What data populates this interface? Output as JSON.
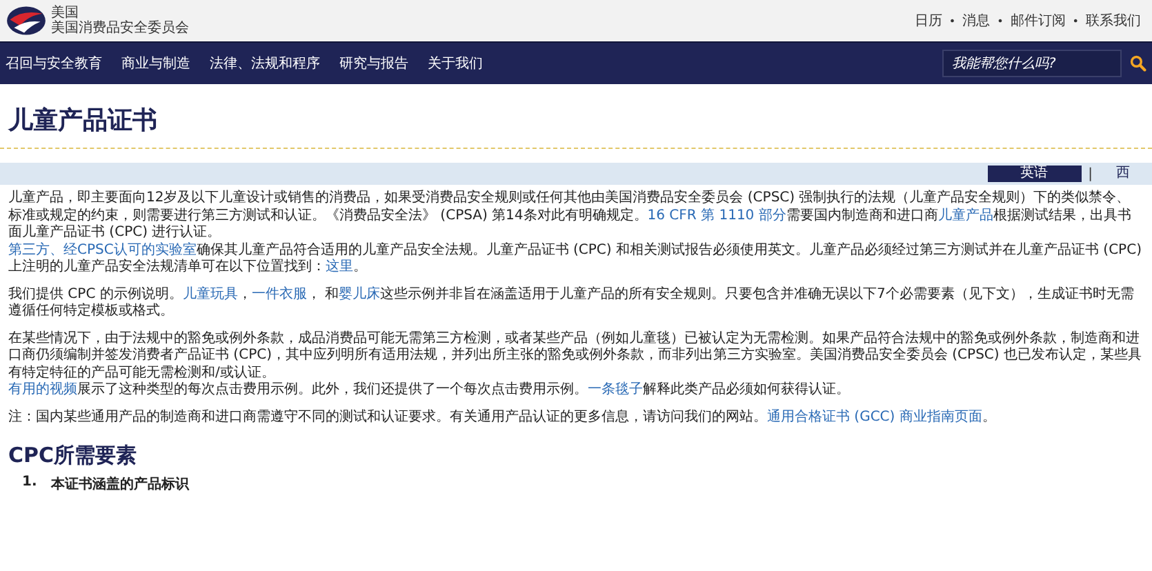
{
  "header": {
    "agency_line_1": "美国",
    "agency_line_2": "美国消费品安全委员会",
    "utility_links": [
      "日历",
      "消息",
      "邮件订阅",
      "联系我们"
    ],
    "separator": "•"
  },
  "nav": {
    "items": [
      "召回与安全教育",
      "商业与制造",
      "法律、法规和程序",
      "研究与报告",
      "关于我们"
    ],
    "search": {
      "placeholder": "我能帮您什么吗?"
    }
  },
  "page_title": "儿童产品证书",
  "languages": {
    "items": [
      {
        "label": "英语",
        "selected": true
      },
      {
        "label": "西",
        "selected": false
      }
    ],
    "separator": "|"
  },
  "paragraphs": [
    {
      "lines": [
        [
          {
            "kind": "text",
            "text": "儿童产品，即主要面向12岁及以下儿童设计或销售的消费品，如果受消费品安全规则或任何其他由美国消费品安全委员会 (CPSC) 强制执行的法规（儿童产品安全规则）下的类似禁令、标准或规定的约束，则需要进行第三方测试和认证。《消费品安全法》 (CPSA) 第14条对此有明确规定。"
          },
          {
            "kind": "link",
            "text": "16 CFR 第 1110 部分"
          },
          {
            "kind": "text",
            "text": "需要国内制造商和进口商"
          },
          {
            "kind": "link",
            "text": "儿童产品"
          },
          {
            "kind": "text",
            "text": "根据测试结果，出具书面儿童产品证书 (CPC) 进行认证。"
          }
        ],
        [
          {
            "kind": "link",
            "text": "第三方、经CPSC认可的实验室"
          },
          {
            "kind": "text",
            "text": "确保其儿童产品符合适用的儿童产品安全法规。儿童产品证书 (CPC) 和相关测试报告必须使用英文。儿童产品必须经过第三方测试并在儿童产品证书 (CPC) 上注明的儿童产品安全法规清单可在以下位置找到："
          },
          {
            "kind": "link",
            "text": "这里"
          },
          {
            "kind": "text",
            "text": "。"
          }
        ]
      ]
    },
    {
      "lines": [
        [
          {
            "kind": "text",
            "text": "我们提供 CPC 的示例说明。"
          },
          {
            "kind": "link",
            "text": "儿童玩具"
          },
          {
            "kind": "text",
            "text": "，"
          },
          {
            "kind": "link",
            "text": "一件衣服"
          },
          {
            "kind": "text",
            "text": "， 和"
          },
          {
            "kind": "link",
            "text": "婴儿床"
          },
          {
            "kind": "text",
            "text": "这些示例并非旨在涵盖适用于儿童产品的所有安全规则。只要包含并准确无误以下7个必需要素（见下文），生成证书时无需遵循任何特定模板或格式。"
          }
        ]
      ]
    },
    {
      "lines": [
        [
          {
            "kind": "text",
            "text": "在某些情况下，由于法规中的豁免或例外条款，成品消费品可能无需第三方检测，或者某些产品（例如儿童毯）已被认定为无需检测。如果产品符合法规中的豁免或例外条款，制造商和进口商仍须编制并签发消费者产品证书 (CPC)，其中应列明所有适用法规，并列出所主张的豁免或例外条款，而非列出第三方实验室。美国消费品安全委员会 (CPSC) 也已发布认定，某些具有特定特征的产品可能无需检测和/或认证。"
          }
        ],
        [
          {
            "kind": "link",
            "text": "有用的视频"
          },
          {
            "kind": "text",
            "text": "展示了这种类型的每次点击费用示例。此外，我们还提供了一个每次点击费用示例。"
          },
          {
            "kind": "link",
            "text": "一条毯子"
          },
          {
            "kind": "text",
            "text": "解释此类产品必须如何获得认证。"
          }
        ]
      ]
    },
    {
      "lines": [
        [
          {
            "kind": "text",
            "text": "注：国内某些通用产品的制造商和进口商需遵守不同的测试和认证要求。有关通用产品认证的更多信息，请访问我们的网站。"
          },
          {
            "kind": "link",
            "text": "通用合格证书 (GCC) 商业指南页面"
          },
          {
            "kind": "text",
            "text": "。"
          }
        ]
      ]
    }
  ],
  "section_heading": "CPC所需要素",
  "requirements": [
    {
      "number": "1.",
      "text": "本证书涵盖的产品标识"
    }
  ]
}
